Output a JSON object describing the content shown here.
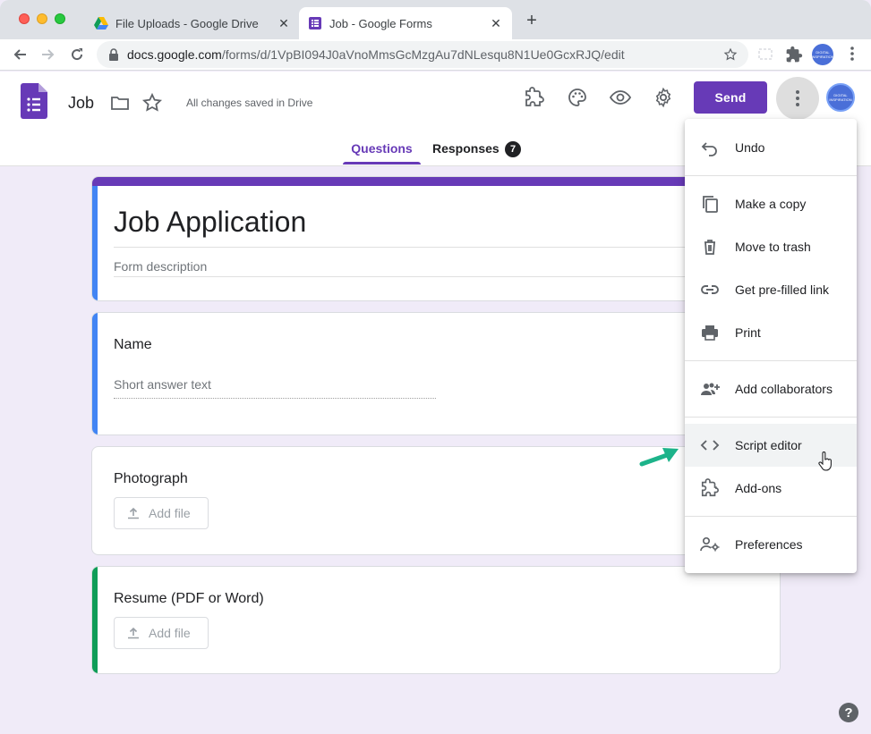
{
  "browser": {
    "tabs": [
      {
        "title": "File Uploads - Google Drive",
        "icon": "google-drive-icon",
        "active": false
      },
      {
        "title": "Job - Google Forms",
        "icon": "google-forms-icon",
        "active": true
      }
    ],
    "url_host": "docs.google.com",
    "url_path": "/forms/d/1VpBI094J0aVnoMmsGcMzgAu7dNLesqu8N1Ue0GcxRJQ/edit"
  },
  "header": {
    "doc_title": "Job",
    "saved_status": "All changes saved in Drive",
    "send_label": "Send",
    "avatar_text": "DIGITAL INSPIRATION",
    "tabs": {
      "questions": "Questions",
      "responses": "Responses",
      "responses_count": "7"
    }
  },
  "form": {
    "title": "Job Application",
    "description_placeholder": "Form description",
    "questions": [
      {
        "title": "Name",
        "placeholder": "Short answer text"
      },
      {
        "title": "Photograph",
        "button": "Add file"
      },
      {
        "title": "Resume (PDF or Word)",
        "button": "Add file"
      }
    ]
  },
  "menu": {
    "items": [
      {
        "label": "Undo",
        "icon": "undo-icon"
      },
      {
        "label": "Make a copy",
        "icon": "copy-icon"
      },
      {
        "label": "Move to trash",
        "icon": "trash-icon"
      },
      {
        "label": "Get pre-filled link",
        "icon": "link-icon"
      },
      {
        "label": "Print",
        "icon": "print-icon"
      },
      {
        "label": "Add collaborators",
        "icon": "add-people-icon"
      },
      {
        "label": "Script editor",
        "icon": "code-icon"
      },
      {
        "label": "Add-ons",
        "icon": "puzzle-icon"
      },
      {
        "label": "Preferences",
        "icon": "person-settings-icon"
      }
    ]
  },
  "colors": {
    "accent": "#673ab7",
    "background": "#f0ebf8",
    "question_bar_blue": "#4285f4",
    "question_bar_green": "#0f9d58",
    "annotation_arrow": "#1db38a"
  },
  "help_label": "?"
}
